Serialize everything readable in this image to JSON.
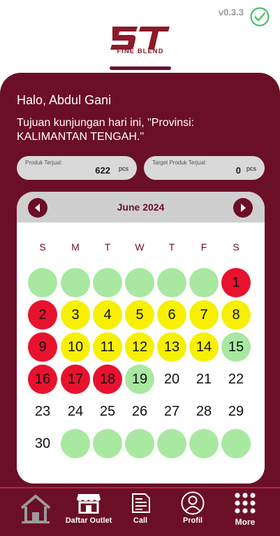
{
  "header": {
    "version": "v0.3.3",
    "logo_text": "5T",
    "logo_subtitle": "FINE BLEND",
    "brand_color": "#6b0f26",
    "check_color": "#4cbf6a"
  },
  "greeting": "Halo, Abdul Gani",
  "visit_text": "Tujuan kunjungan hari ini, \"Provinsi: KALIMANTAN TENGAH.\"",
  "stats": {
    "sold_label": "Produk Terjual:",
    "sold_value": "622",
    "sold_unit": "pcs",
    "target_label": "Target Produk Terjual:",
    "target_value": "0",
    "target_unit": "pcs"
  },
  "calendar": {
    "month_label": "June 2024",
    "prev_icon": "chevron-left-icon",
    "next_icon": "chevron-right-icon",
    "weekdays": [
      "S",
      "M",
      "T",
      "W",
      "T",
      "F",
      "S"
    ],
    "status_colors": {
      "green": "#a8e8a0",
      "red": "#e8122e",
      "yellow": "#f7f000"
    },
    "weeks": [
      [
        {
          "d": "",
          "s": "green"
        },
        {
          "d": "",
          "s": "green"
        },
        {
          "d": "",
          "s": "green"
        },
        {
          "d": "",
          "s": "green"
        },
        {
          "d": "",
          "s": "green"
        },
        {
          "d": "",
          "s": "green"
        },
        {
          "d": "1",
          "s": "red"
        }
      ],
      [
        {
          "d": "2",
          "s": "red"
        },
        {
          "d": "3",
          "s": "yellow"
        },
        {
          "d": "4",
          "s": "yellow"
        },
        {
          "d": "5",
          "s": "yellow"
        },
        {
          "d": "6",
          "s": "yellow"
        },
        {
          "d": "7",
          "s": "yellow"
        },
        {
          "d": "8",
          "s": "yellow"
        }
      ],
      [
        {
          "d": "9",
          "s": "red"
        },
        {
          "d": "10",
          "s": "yellow"
        },
        {
          "d": "11",
          "s": "yellow"
        },
        {
          "d": "12",
          "s": "yellow"
        },
        {
          "d": "13",
          "s": "yellow"
        },
        {
          "d": "14",
          "s": "yellow"
        },
        {
          "d": "15",
          "s": "green"
        }
      ],
      [
        {
          "d": "16",
          "s": "red"
        },
        {
          "d": "17",
          "s": "red"
        },
        {
          "d": "18",
          "s": "red"
        },
        {
          "d": "19",
          "s": "green"
        },
        {
          "d": "20",
          "s": "none"
        },
        {
          "d": "21",
          "s": "none"
        },
        {
          "d": "22",
          "s": "none"
        }
      ],
      [
        {
          "d": "23",
          "s": "none"
        },
        {
          "d": "24",
          "s": "none"
        },
        {
          "d": "25",
          "s": "none"
        },
        {
          "d": "26",
          "s": "none"
        },
        {
          "d": "27",
          "s": "none"
        },
        {
          "d": "28",
          "s": "none"
        },
        {
          "d": "29",
          "s": "none"
        }
      ],
      [
        {
          "d": "30",
          "s": "none"
        },
        {
          "d": "",
          "s": "green"
        },
        {
          "d": "",
          "s": "green"
        },
        {
          "d": "",
          "s": "green"
        },
        {
          "d": "",
          "s": "green"
        },
        {
          "d": "",
          "s": "green"
        },
        {
          "d": "",
          "s": "green"
        }
      ]
    ]
  },
  "bottom_nav": [
    {
      "label": "",
      "icon": "home-icon"
    },
    {
      "label": "Daftar Outlet",
      "icon": "store-icon"
    },
    {
      "label": "Call",
      "icon": "invoice-icon"
    },
    {
      "label": "Profil",
      "icon": "profile-icon"
    },
    {
      "label": "More",
      "icon": "more-grid-icon"
    }
  ]
}
